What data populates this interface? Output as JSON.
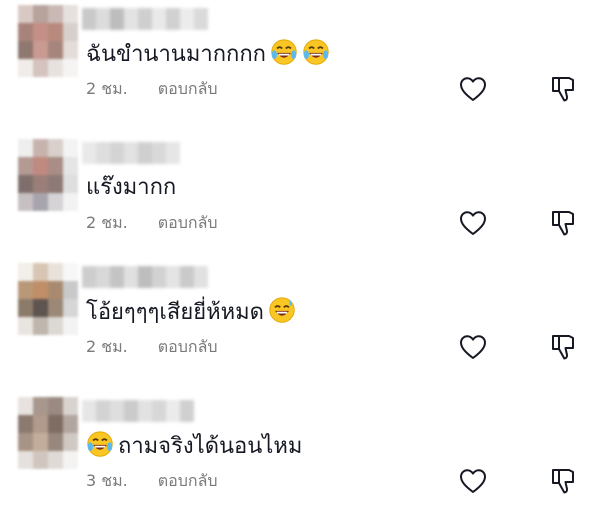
{
  "comments": [
    {
      "text": "ฉันขำนานมากกกก",
      "emojis_after": [
        "laughing-tears-emoji",
        "laughing-tears-emoji"
      ],
      "emoji_before": null,
      "time": "2 ชม.",
      "reply_label": "ตอบกลับ"
    },
    {
      "text": "แร๊งมากก",
      "emojis_after": [],
      "emoji_before": null,
      "time": "2 ชม.",
      "reply_label": "ตอบกลับ"
    },
    {
      "text": "โอ้ยๆๆๆเสียยี่ห้หมด",
      "emojis_after": [
        "grinning-sweat-emoji"
      ],
      "emoji_before": null,
      "time": "2 ชม.",
      "reply_label": "ตอบกลับ"
    },
    {
      "text": "ถามจริงได้นอนไหม",
      "emojis_after": [],
      "emoji_before": "laughing-tears-emoji",
      "time": "3 ชม.",
      "reply_label": "ตอบกลับ"
    }
  ],
  "icons": {
    "like": "heart-outline-icon",
    "dislike": "thumbs-down-outline-icon"
  },
  "colors": {
    "text": "#161823",
    "meta": "#7a7a7a",
    "icon_stroke": "#161823"
  }
}
